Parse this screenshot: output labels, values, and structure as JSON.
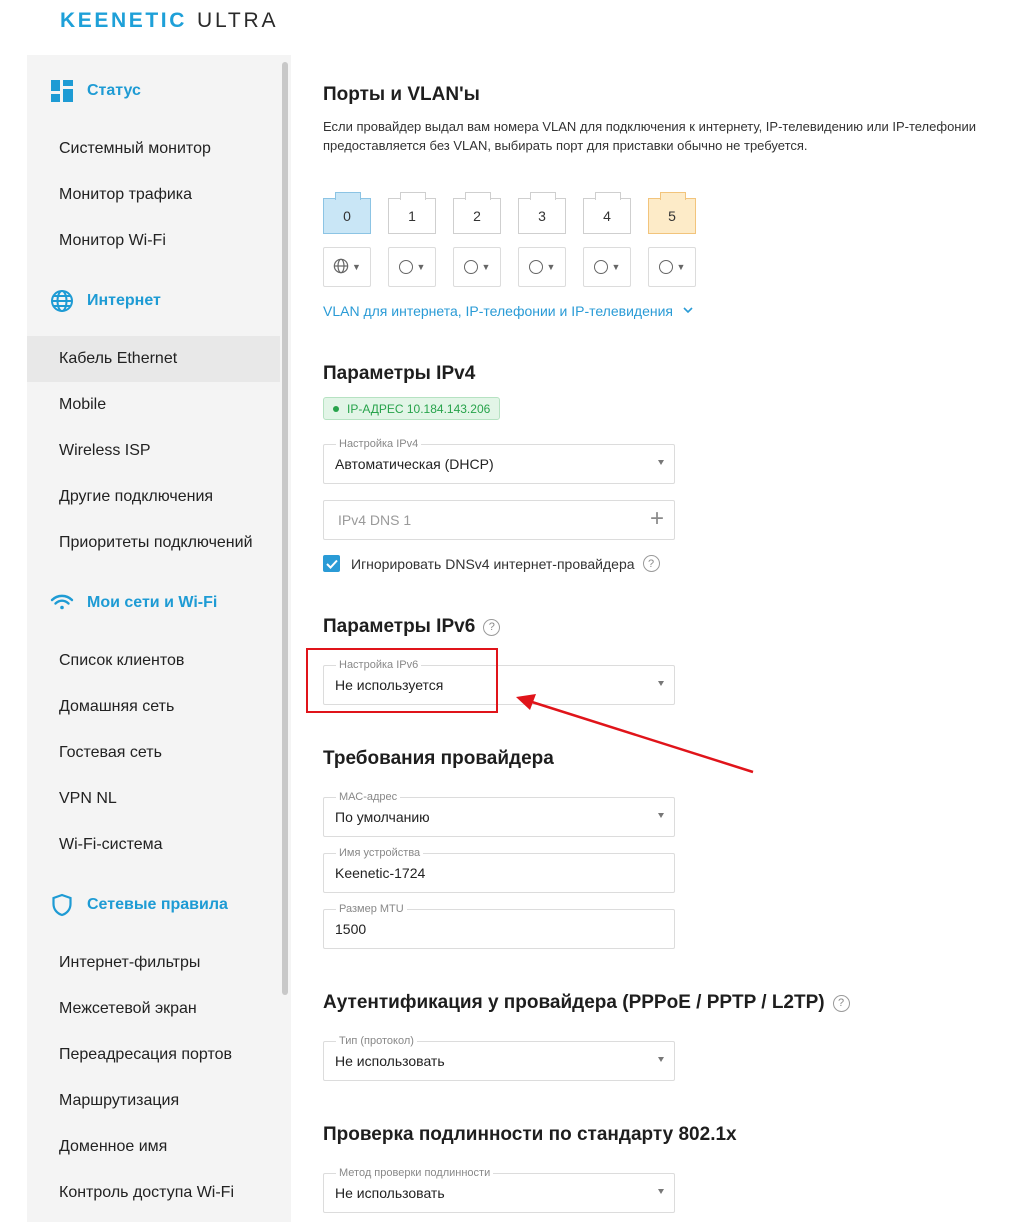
{
  "brand": {
    "name": "KEENETIC",
    "model": "ULTRA"
  },
  "sidebar": {
    "sections": [
      {
        "title": "Статус",
        "icon": "dashboard-icon",
        "items": [
          "Системный монитор",
          "Монитор трафика",
          "Монитор Wi-Fi"
        ]
      },
      {
        "title": "Интернет",
        "icon": "globe-icon",
        "items": [
          "Кабель Ethernet",
          "Mobile",
          "Wireless ISP",
          "Другие подключения",
          "Приоритеты подключений"
        ]
      },
      {
        "title": "Мои сети и Wi-Fi",
        "icon": "wifi-icon",
        "items": [
          "Список клиентов",
          "Домашняя сеть",
          "Гостевая сеть",
          "VPN NL",
          "Wi-Fi-система"
        ]
      },
      {
        "title": "Сетевые правила",
        "icon": "shield-icon",
        "items": [
          "Интернет-фильтры",
          "Межсетевой экран",
          "Переадресация портов",
          "Маршрутизация",
          "Доменное имя",
          "Контроль доступа Wi-Fi"
        ]
      }
    ],
    "active_item": "Кабель Ethernet"
  },
  "ports_section": {
    "title": "Порты и VLAN'ы",
    "description_line1": "Если провайдер выдал вам номера VLAN для подключения к интернету, IP-телевидению или IP-телефонии",
    "description_line2": "предоставляется без VLAN, выбирать порт для приставки обычно не требуется.",
    "ports": [
      "0",
      "1",
      "2",
      "3",
      "4",
      "5"
    ],
    "port_modes": [
      "globe-icon",
      "circle-icon",
      "circle-icon",
      "circle-icon",
      "circle-icon",
      "circle-icon"
    ],
    "vlan_link": "VLAN для интернета, IP-телефонии и IP-телевидения"
  },
  "ipv4": {
    "title": "Параметры IPv4",
    "status_badge": "IP-АДРЕС 10.184.143.206",
    "setting_label": "Настройка IPv4",
    "setting_value": "Автоматическая (DHCP)",
    "dns_placeholder": "IPv4 DNS 1",
    "ignore_dns_label": "Игнорировать DNSv4 интернет-провайдера",
    "ignore_dns_checked": true
  },
  "ipv6": {
    "title": "Параметры IPv6",
    "setting_label": "Настройка IPv6",
    "setting_value": "Не используется"
  },
  "provider": {
    "title": "Требования провайдера",
    "mac_label": "МАС-адрес",
    "mac_value": "По умолчанию",
    "device_name_label": "Имя устройства",
    "device_name_value": "Keenetic-1724",
    "mtu_label": "Размер MTU",
    "mtu_value": "1500"
  },
  "auth": {
    "title": "Аутентификация у провайдера (PPPoE / PPTP / L2TP)",
    "type_label": "Тип (протокол)",
    "type_value": "Не использовать"
  },
  "dot1x": {
    "title": "Проверка подлинности по стандарту 802.1x",
    "method_label": "Метод проверки подлинности",
    "method_value": "Не использовать"
  },
  "colors": {
    "accent": "#1e9bd4",
    "highlight": "#e0141a",
    "status_ok": "#27a34b"
  }
}
